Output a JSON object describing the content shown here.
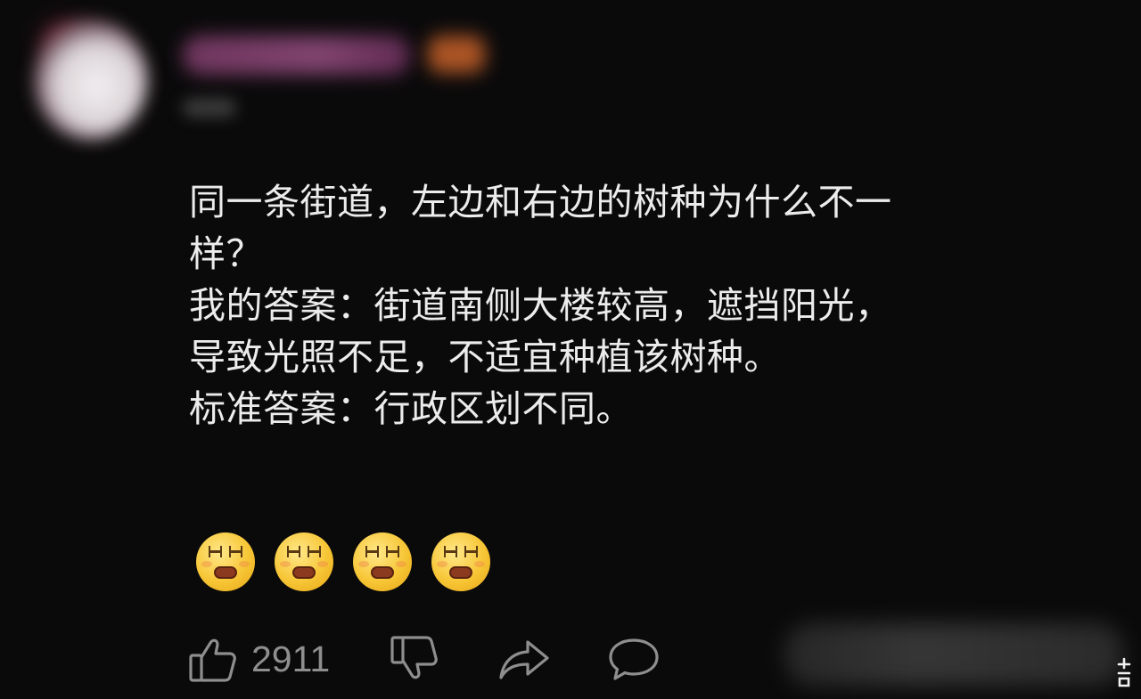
{
  "comment": {
    "lines": [
      "同一条街道，左边和右边的树种为什么不一",
      "样？",
      "我的答案：街道南侧大楼较高，遮挡阳光，",
      "导致光照不足，不适宜种植该树种。",
      "标准答案：行政区划不同。"
    ],
    "emojis": [
      "grimace-emoji",
      "grimace-emoji",
      "grimace-emoji",
      "grimace-emoji"
    ]
  },
  "actions": {
    "like_count": "2911",
    "icons": [
      "thumbs-up-icon",
      "thumbs-down-icon",
      "share-icon",
      "comment-bubble-icon"
    ]
  },
  "colors": {
    "background": "#0b0a0b",
    "text": "#ececec",
    "action_gray": "#8e8e8e",
    "emoji_yellow": "#f7c636"
  }
}
